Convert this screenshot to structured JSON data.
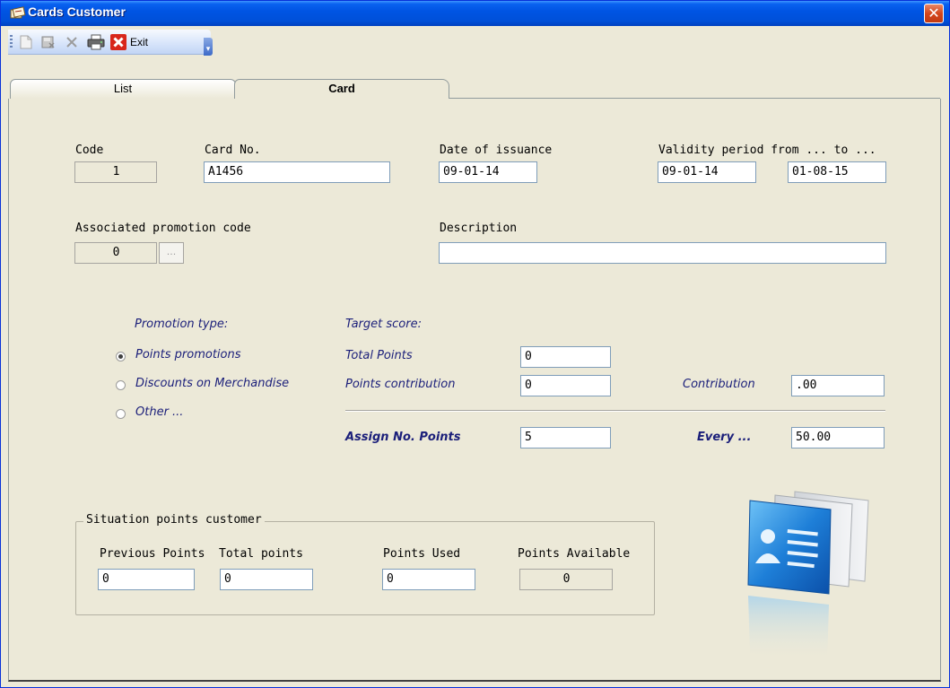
{
  "window": {
    "title": "Cards Customer",
    "close_glyph": "✕"
  },
  "toolbar": {
    "items": [
      {
        "icon": "new-document-icon"
      },
      {
        "icon": "save-icon"
      },
      {
        "icon": "delete-x-icon"
      },
      {
        "icon": "printer-icon"
      },
      {
        "icon": "exit-red-x-icon",
        "label": "Exit"
      }
    ]
  },
  "tabs": [
    {
      "label": "List",
      "active": false
    },
    {
      "label": "Card",
      "active": true
    }
  ],
  "card": {
    "code_label": "Code",
    "code_value": "1",
    "card_no_label": "Card No.",
    "card_no_value": "A1456",
    "date_issuance_label": "Date of issuance",
    "date_issuance_value": "09-01-14",
    "validity_label": "Validity period from ... to ...",
    "validity_from": "09-01-14",
    "validity_to": "01-08-15",
    "promo_code_label": "Associated promotion code",
    "promo_code_value": "0",
    "promo_code_button": "...",
    "description_label": "Description",
    "description_value": ""
  },
  "promotion": {
    "type_label": "Promotion type:",
    "options": [
      {
        "label": "Points promotions",
        "selected": true
      },
      {
        "label": "Discounts on Merchandise",
        "selected": false
      },
      {
        "label": "Other ...",
        "selected": false
      }
    ],
    "target_label": "Target score:",
    "total_points_label": "Total Points",
    "total_points_value": "0",
    "points_contribution_label": "Points contribution",
    "points_contribution_value": "0",
    "contribution_label": "Contribution",
    "contribution_value": ".00",
    "assign_label": "Assign No. Points",
    "assign_value": "5",
    "every_label": "Every ...",
    "every_value": "50.00"
  },
  "situation": {
    "title": "Situation points customer",
    "previous_label": "Previous Points",
    "previous_value": "0",
    "total_label": "Total points",
    "total_value": "0",
    "used_label": "Points Used",
    "used_value": "0",
    "available_label": "Points Available",
    "available_value": "0"
  },
  "colors": {
    "title_bar": "#0054e3",
    "accent_text": "#1b1f7a",
    "window_bg": "#ece9d8"
  }
}
